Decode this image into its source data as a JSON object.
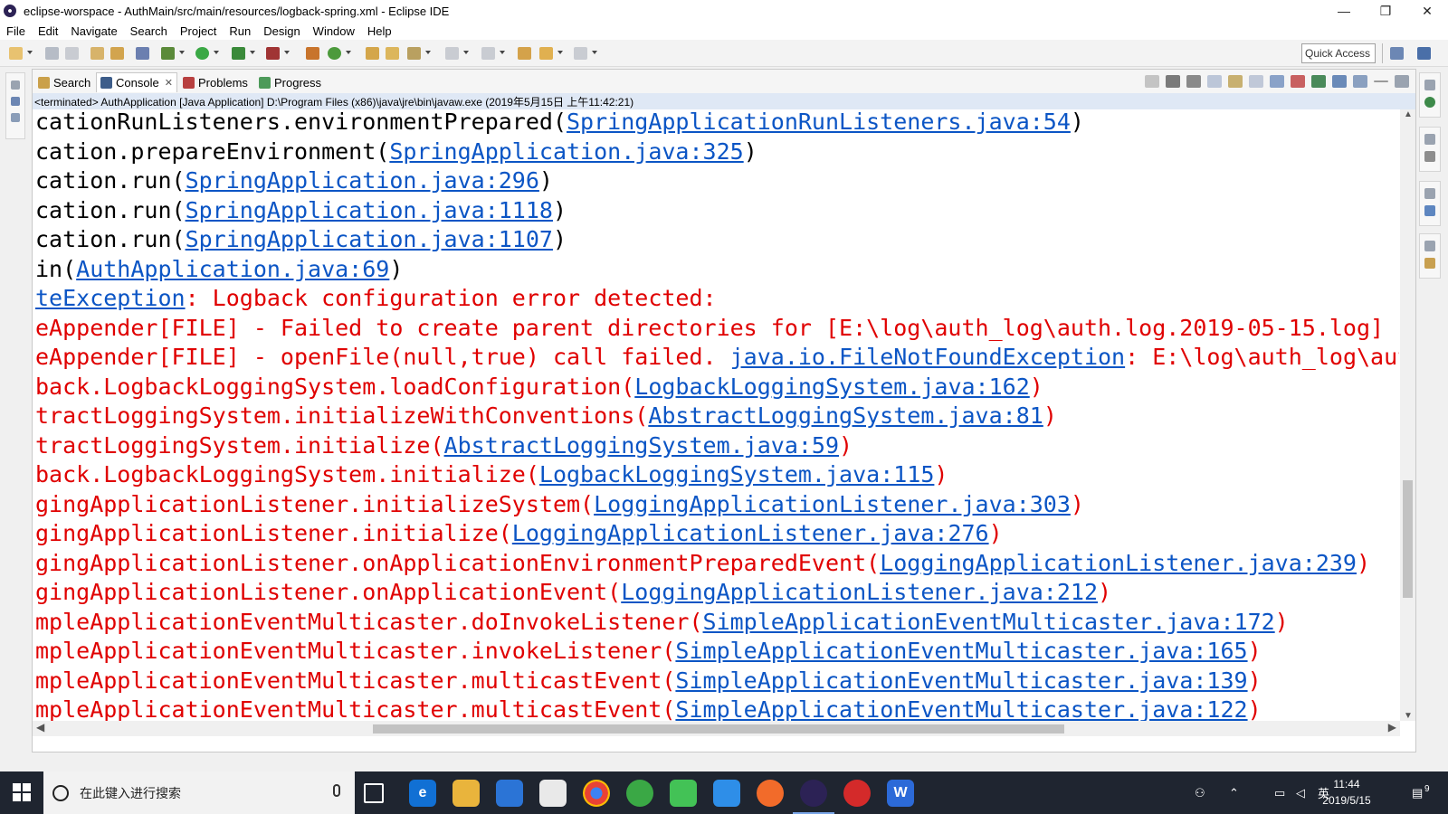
{
  "window": {
    "title": "eclipse-worspace - AuthMain/src/main/resources/logback-spring.xml - Eclipse IDE",
    "minimize": "—",
    "restore": "❐",
    "close": "✕"
  },
  "menu": [
    "File",
    "Edit",
    "Navigate",
    "Search",
    "Project",
    "Run",
    "Design",
    "Window",
    "Help"
  ],
  "toolbar": {
    "quick_access_placeholder": "Quick Access"
  },
  "view": {
    "tabs": [
      {
        "label": "Search",
        "icon": "search-icon"
      },
      {
        "label": "Console",
        "icon": "console-icon",
        "close": "✕"
      },
      {
        "label": "Problems",
        "icon": "problems-icon"
      },
      {
        "label": "Progress",
        "icon": "progress-icon"
      }
    ],
    "status": "<terminated> AuthApplication [Java Application] D:\\Program Files (x86)\\java\\jre\\bin\\javaw.exe (2019年5月15日 上午11:42:21)"
  },
  "console": {
    "lines": [
      {
        "color": "black",
        "text": "cationRunListeners.environmentPrepared(",
        "link": "SpringApplicationRunListeners.java:54",
        "suffix": ")"
      },
      {
        "color": "black",
        "text": "cation.prepareEnvironment(",
        "link": "SpringApplication.java:325",
        "suffix": ")"
      },
      {
        "color": "black",
        "text": "cation.run(",
        "link": "SpringApplication.java:296",
        "suffix": ")"
      },
      {
        "color": "black",
        "text": "cation.run(",
        "link": "SpringApplication.java:1118",
        "suffix": ")"
      },
      {
        "color": "black",
        "text": "cation.run(",
        "link": "SpringApplication.java:1107",
        "suffix": ")"
      },
      {
        "color": "black",
        "text": "in(",
        "link": "AuthApplication.java:69",
        "suffix": ")"
      },
      {
        "color": "red",
        "text": "",
        "link": "teException",
        "suffix": ": Logback configuration error detected:"
      },
      {
        "color": "red",
        "text": "eAppender[FILE] - Failed to create parent directories for [E:\\log\\auth_log\\auth.log.2019-05-15.log]",
        "link": "",
        "suffix": ""
      },
      {
        "color": "red",
        "text": "eAppender[FILE] - openFile(null,true) call failed. ",
        "link": "java.io.FileNotFoundException",
        "suffix": ": E:\\log\\auth_log\\aut"
      },
      {
        "color": "red",
        "text": "back.LogbackLoggingSystem.loadConfiguration(",
        "link": "LogbackLoggingSystem.java:162",
        "suffix": ")"
      },
      {
        "color": "red",
        "text": "tractLoggingSystem.initializeWithConventions(",
        "link": "AbstractLoggingSystem.java:81",
        "suffix": ")"
      },
      {
        "color": "red",
        "text": "tractLoggingSystem.initialize(",
        "link": "AbstractLoggingSystem.java:59",
        "suffix": ")"
      },
      {
        "color": "red",
        "text": "back.LogbackLoggingSystem.initialize(",
        "link": "LogbackLoggingSystem.java:115",
        "suffix": ")"
      },
      {
        "color": "red",
        "text": "gingApplicationListener.initializeSystem(",
        "link": "LoggingApplicationListener.java:303",
        "suffix": ")"
      },
      {
        "color": "red",
        "text": "gingApplicationListener.initialize(",
        "link": "LoggingApplicationListener.java:276",
        "suffix": ")"
      },
      {
        "color": "red",
        "text": "gingApplicationListener.onApplicationEnvironmentPreparedEvent(",
        "link": "LoggingApplicationListener.java:239",
        "suffix": ")"
      },
      {
        "color": "red",
        "text": "gingApplicationListener.onApplicationEvent(",
        "link": "LoggingApplicationListener.java:212",
        "suffix": ")"
      },
      {
        "color": "red",
        "text": "mpleApplicationEventMulticaster.doInvokeListener(",
        "link": "SimpleApplicationEventMulticaster.java:172",
        "suffix": ")"
      },
      {
        "color": "red",
        "text": "mpleApplicationEventMulticaster.invokeListener(",
        "link": "SimpleApplicationEventMulticaster.java:165",
        "suffix": ")"
      },
      {
        "color": "red",
        "text": "mpleApplicationEventMulticaster.multicastEvent(",
        "link": "SimpleApplicationEventMulticaster.java:139",
        "suffix": ")"
      },
      {
        "color": "red",
        "text": "mpleApplicationEventMulticaster.multicastEvent(",
        "link": "SimpleApplicationEventMulticaster.java:122",
        "suffix": ")"
      }
    ]
  },
  "taskbar": {
    "search_placeholder": "在此键入进行搜索",
    "ime": "英",
    "time": "11:44",
    "date": "2019/5/15",
    "notification_count": "9"
  },
  "colors": {
    "console_black": "#000000",
    "console_red": "#e00000",
    "link_blue": "#0b55c5",
    "status_bg": "#dfe8f5",
    "taskbar_bg": "#1f2530"
  }
}
